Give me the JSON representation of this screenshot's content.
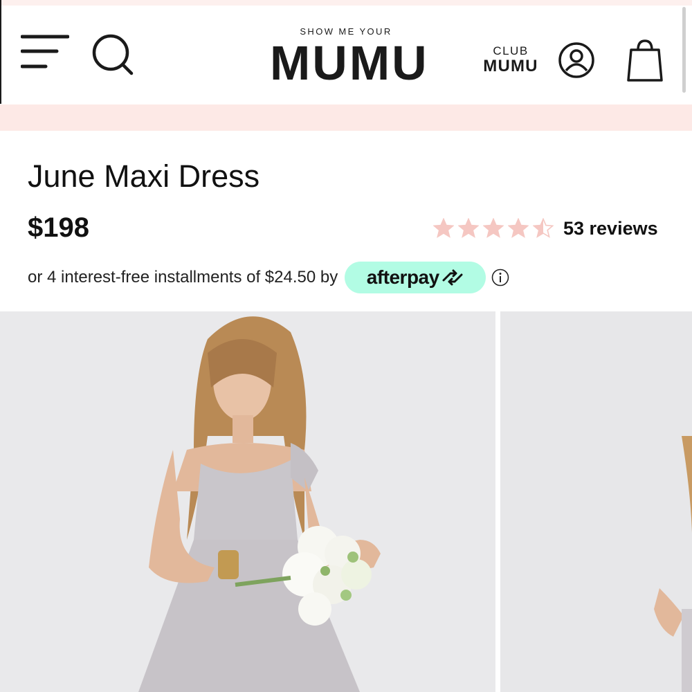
{
  "header": {
    "menu_icon": "hamburger-menu-icon",
    "search_icon": "search-icon",
    "logo_top": "SHOW ME YOUR",
    "logo_main": "MUMU",
    "club_top": "CLUB",
    "club_main": "MUMU",
    "account_icon": "user-account-icon",
    "bag_icon": "shopping-bag-icon"
  },
  "product": {
    "title": "June Maxi Dress",
    "price": "$198",
    "rating": {
      "value": 4.5,
      "max": 5,
      "reviews_label": "53 reviews",
      "star_color": "#f5c7c2"
    },
    "installments_text": "or 4 interest-free installments of $24.50 by",
    "afterpay": {
      "label": "afterpay",
      "color": "#b2fce4"
    },
    "info_icon": "info-icon"
  },
  "gallery": {
    "images": [
      {
        "name": "product-photo-model-front"
      },
      {
        "name": "product-photo-model-side"
      }
    ]
  },
  "colors": {
    "promo_banner": "#fde9e6",
    "text": "#111111",
    "photo_background": "#e8e8ea"
  }
}
